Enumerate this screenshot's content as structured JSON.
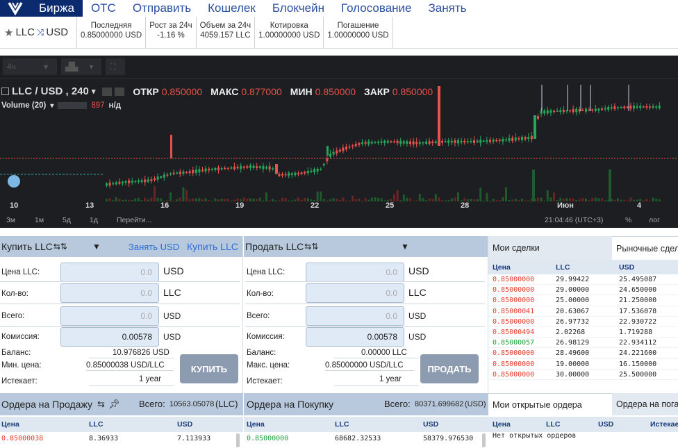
{
  "nav": {
    "items": [
      "Биржа",
      "OTC",
      "Отправить",
      "Кошелек",
      "Блокчейн",
      "Голосование",
      "Занять"
    ],
    "active": 0
  },
  "ticker": {
    "base": "LLC",
    "quote": "USD",
    "stats": [
      {
        "label": "Последняя",
        "value": "0.85000000 USD",
        "color": "#333333"
      },
      {
        "label": "Рост за 24ч",
        "value": "-1.16 %",
        "color": "#e63b2e"
      },
      {
        "label": "Объем за 24ч",
        "value": "4059.157 LLC",
        "color": "#333333"
      },
      {
        "label": "Котировка",
        "value": "1.00000000 USD",
        "color": "#c9b200"
      },
      {
        "label": "Погашение",
        "value": "1.00000000 USD",
        "color": "#c9b200"
      }
    ]
  },
  "chart": {
    "toolbar": {
      "interval": "4ч"
    },
    "title": "LLC / USD , 240",
    "ohlc": {
      "open_label": "ОТКР",
      "open": "0.850000",
      "high_label": "МАКС",
      "high": "0.877000",
      "low_label": "МИН",
      "low": "0.850000",
      "close_label": "ЗАКР",
      "close": "0.850000"
    },
    "volume_label": "Volume (20)",
    "volume_value": "897",
    "volume_na": "н/д",
    "x_labels": [
      "10",
      "13",
      "16",
      "19",
      "22",
      "25",
      "28",
      "Июн",
      "4"
    ],
    "ranges": [
      "3м",
      "1м",
      "5д",
      "1д",
      "Перейти..."
    ],
    "time": "21:04:46 (UTC+3)",
    "percent": "%",
    "log": "лог",
    "colors": {
      "up": "#26a65b",
      "down": "#e8524a",
      "bg": "#1d1e22"
    }
  },
  "chart_data": {
    "type": "candlestick",
    "x_ticks": [
      "10",
      "13",
      "16",
      "19",
      "22",
      "25",
      "28",
      "Июн",
      "4"
    ],
    "ohlc_current": {
      "open": 0.85,
      "high": 0.877,
      "low": 0.85,
      "close": 0.85
    },
    "volume_current": 897
  },
  "buy": {
    "title": "Купить LLC",
    "link_borrow": "Занять USD",
    "link_buy": "Купить LLC",
    "price_label": "Цена LLC:",
    "price": "0.0",
    "price_unit": "USD",
    "qty_label": "Кол-во:",
    "qty": "0.0",
    "qty_unit": "LLC",
    "total_label": "Всего:",
    "total": "0.0",
    "total_unit": "USD",
    "fee_label": "Комиссия:",
    "fee": "0.00578",
    "fee_unit": "USD",
    "balance_label": "Баланс:",
    "balance": "10.976826 USD",
    "minprice_label": "Мин. цена:",
    "minprice": "0.85000038 USD/LLC",
    "expires_label": "Истекает:",
    "expires": "1 year",
    "button": "КУПИТЬ"
  },
  "sell": {
    "title": "Продать LLC",
    "price_label": "Цена LLC:",
    "price": "0.0",
    "price_unit": "USD",
    "qty_label": "Кол-во:",
    "qty": "0.0",
    "qty_unit": "LLC",
    "total_label": "Всего:",
    "total": "0.0",
    "total_unit": "USD",
    "fee_label": "Комиссия:",
    "fee": "0.00578",
    "fee_unit": "USD",
    "balance_label": "Баланс:",
    "balance": "0.00000 LLC",
    "maxprice_label": "Макс. цена:",
    "maxprice": "0.85000000 USD/LLC",
    "expires_label": "Истекает:",
    "expires": "1 year",
    "button": "ПРОДАТЬ"
  },
  "trades": {
    "tab_mine": "Мои сделки",
    "tab_market": "Рыночные сделки",
    "headers": [
      "Цена",
      "LLC",
      "USD"
    ],
    "rows": [
      {
        "price": "0.85000000",
        "llc": "29.99422",
        "usd": "25.495087",
        "color": "#e63b2e"
      },
      {
        "price": "0.85000000",
        "llc": "29.00000",
        "usd": "24.650000",
        "color": "#e63b2e"
      },
      {
        "price": "0.85000000",
        "llc": "25.00000",
        "usd": "21.250000",
        "color": "#e63b2e"
      },
      {
        "price": "0.85000041",
        "llc": "20.63067",
        "usd": "17.536078",
        "color": "#e63b2e"
      },
      {
        "price": "0.85000000",
        "llc": "26.97732",
        "usd": "22.930722",
        "color": "#e63b2e"
      },
      {
        "price": "0.85000494",
        "llc": "2.02268",
        "usd": "1.719288",
        "color": "#e63b2e"
      },
      {
        "price": "0.85000057",
        "llc": "26.98129",
        "usd": "22.934112",
        "color": "#1fa33a"
      },
      {
        "price": "0.85000000",
        "llc": "28.49600",
        "usd": "24.221600",
        "color": "#e63b2e"
      },
      {
        "price": "0.85000000",
        "llc": "19.00000",
        "usd": "16.150000",
        "color": "#e63b2e"
      },
      {
        "price": "0.85000000",
        "llc": "30.00000",
        "usd": "25.500000",
        "color": "#e63b2e"
      }
    ]
  },
  "sell_orders": {
    "title": "Ордера на Продажу",
    "total_label": "Всего:",
    "total": "10563.05078",
    "total_unit": "(LLC)",
    "headers": [
      "Цена",
      "LLC",
      "USD"
    ],
    "row": {
      "price": "0.85000038",
      "llc": "8.36933",
      "usd": "7.113933"
    }
  },
  "buy_orders": {
    "title": "Ордера на Покупку",
    "total_label": "Всего:",
    "total": "80371.699682",
    "total_unit": "(USD)",
    "headers": [
      "Цена",
      "LLC",
      "USD"
    ],
    "row": {
      "price": "0.85000000",
      "llc": "68682.32533",
      "usd": "58379.976530"
    }
  },
  "open_orders": {
    "tab_mine": "Мои открытые ордера",
    "tab_market": "Ордера на погашение",
    "headers": [
      "Цена",
      "LLC",
      "USD",
      "Истекает"
    ],
    "empty": "Нет открытых ордеров"
  }
}
